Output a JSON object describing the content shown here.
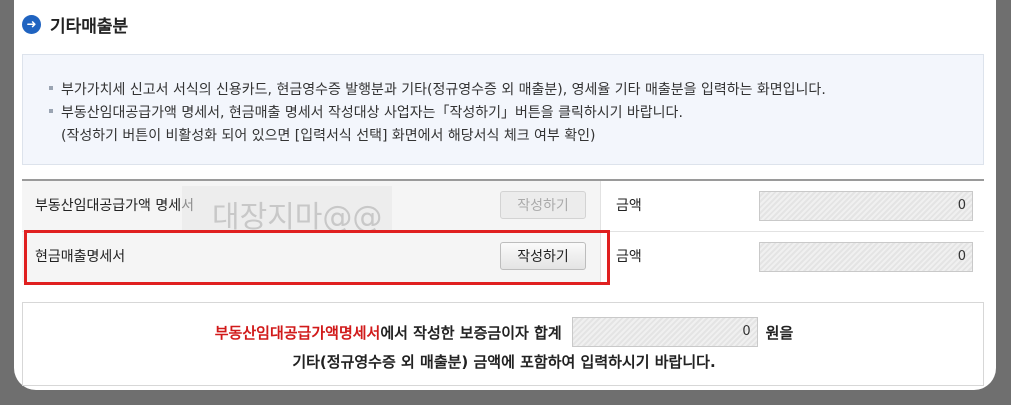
{
  "section": {
    "title": "기타매출분",
    "icon": "arrow-right-circle-icon",
    "accent_color": "#1f63c0"
  },
  "notice": {
    "lines": [
      "부가가치세 신고서 서식의 신용카드, 현금영수증 발행분과 기타(정규영수증 외 매출분), 영세율 기타 매출분을 입력하는 화면입니다.",
      "부동산임대공급가액 명세서, 현금매출 명세서 작성대상 사업자는「작성하기」버튼을 클릭하시기 바랍니다.",
      "(작성하기 버튼이 비활성화 되어 있으면 [입력서식 선택] 화면에서 해당서식 체크 여부 확인)"
    ]
  },
  "form": {
    "watermark_text": "대장지마@@",
    "rows": [
      {
        "label": "부동산임대공급가액 명세서",
        "button_label": "작성하기",
        "button_enabled": false,
        "amount_label": "금액",
        "amount_value": "0"
      },
      {
        "label": "현금매출명세서",
        "button_label": "작성하기",
        "button_enabled": true,
        "amount_label": "금액",
        "amount_value": "0",
        "highlighted": true
      }
    ],
    "highlight_color": "#e02020"
  },
  "summary": {
    "line1_red": "부동산임대공급가액명세서",
    "line1_text": "에서 작성한 보증금이자 합계",
    "deposit_interest_total": "0",
    "line1_suffix": "원을",
    "line2": "기타(정규영수증 외 매출분) 금액에 포함하여 입력하시기 바랍니다.",
    "red_color": "#d11a1a"
  }
}
